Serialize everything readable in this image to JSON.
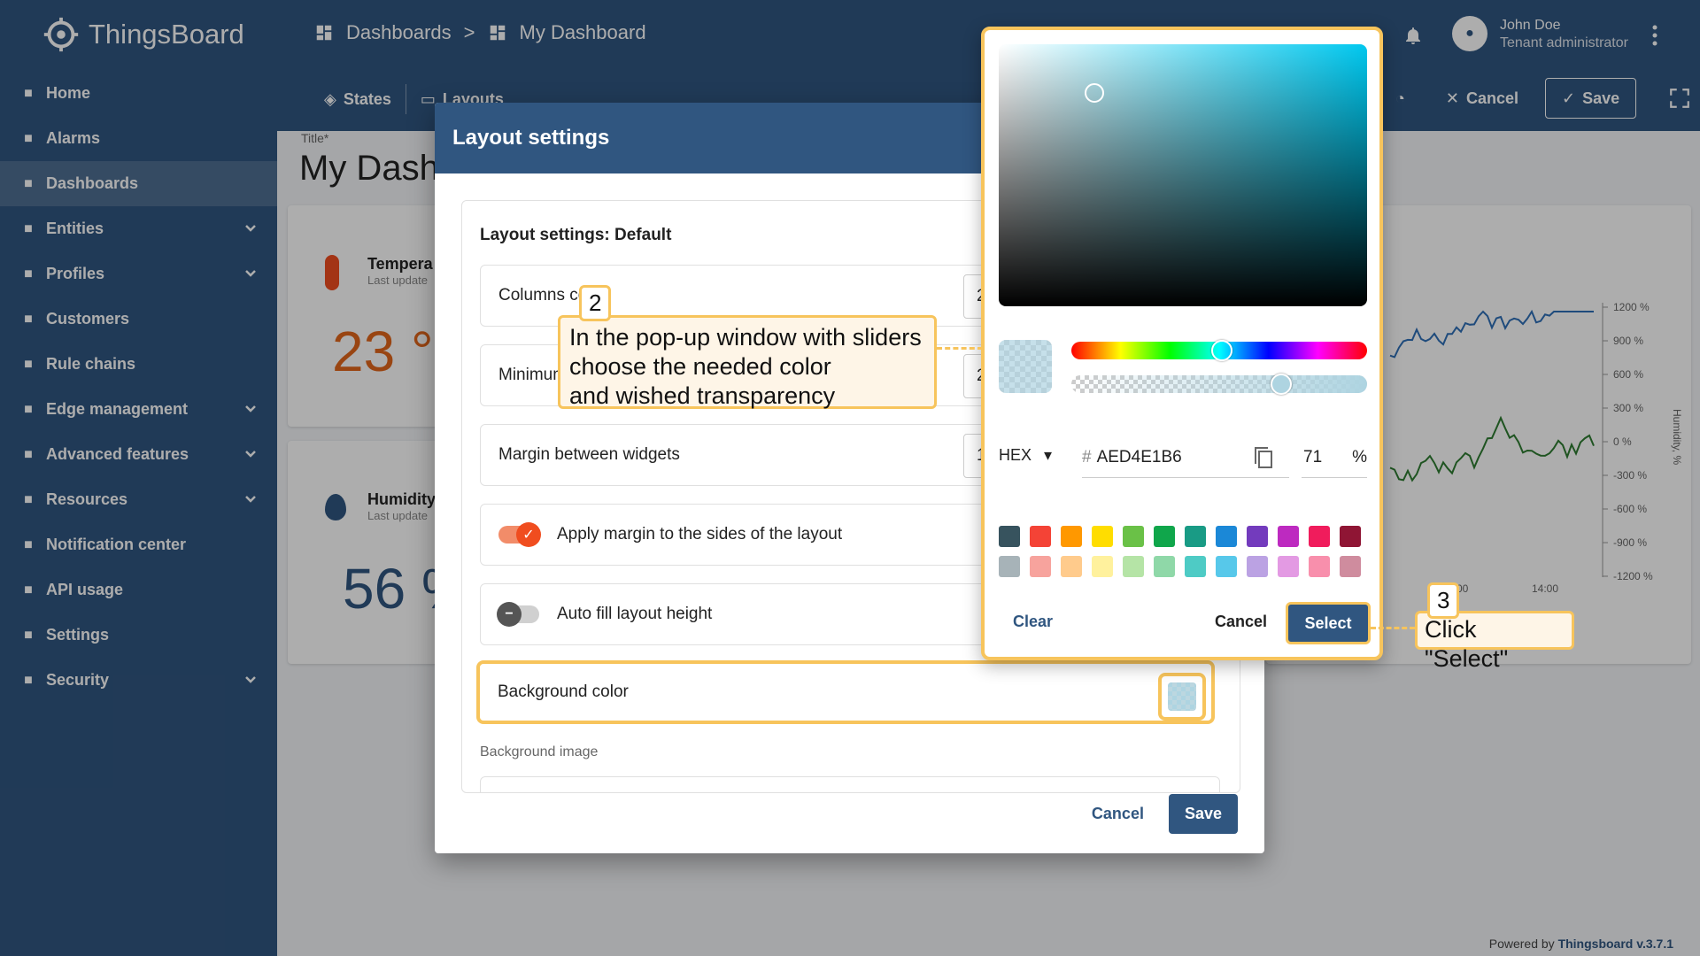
{
  "app": {
    "logo_text": "ThingsBoard",
    "breadcrumb": [
      "Dashboards",
      ">",
      "My Dashboard"
    ],
    "toolbar": {
      "states": "States",
      "layouts": "Layouts"
    },
    "user": {
      "name": "John Doe",
      "role": "Tenant administrator"
    },
    "actions": {
      "cancel": "Cancel",
      "save": "Save"
    },
    "title_label": "Title*",
    "title_value": "My Dash",
    "powered_by_prefix": "Powered by",
    "powered_by_link": "Thingsboard v.3.7.1"
  },
  "sidebar": {
    "items": [
      {
        "label": "Home",
        "icon": "home-icon"
      },
      {
        "label": "Alarms",
        "icon": "alarm-icon"
      },
      {
        "label": "Dashboards",
        "icon": "dashboard-icon"
      },
      {
        "label": "Entities",
        "icon": "entities-icon"
      },
      {
        "label": "Profiles",
        "icon": "profiles-icon"
      },
      {
        "label": "Customers",
        "icon": "customers-icon"
      },
      {
        "label": "Rule chains",
        "icon": "rule-chains-icon"
      },
      {
        "label": "Edge management",
        "icon": "edge-icon"
      },
      {
        "label": "Advanced features",
        "icon": "tools-icon"
      },
      {
        "label": "Resources",
        "icon": "folder-icon"
      },
      {
        "label": "Notification center",
        "icon": "notification-icon"
      },
      {
        "label": "API usage",
        "icon": "chart-icon"
      },
      {
        "label": "Settings",
        "icon": "gear-icon"
      },
      {
        "label": "Security",
        "icon": "shield-icon"
      }
    ]
  },
  "cards": {
    "temperature": {
      "name": "Tempera",
      "sub": "Last update",
      "value": "23 °"
    },
    "humidity": {
      "name": "Humidity",
      "sub": "Last update",
      "value": "56 %"
    }
  },
  "chart": {
    "y_ticks": [
      "1200 %",
      "900 %",
      "600 %",
      "300 %",
      "0 %",
      "-300 %",
      "-600 %",
      "-900 %",
      "-1200 %"
    ],
    "x_ticks": [
      "00",
      "14:00"
    ],
    "y_label": "Humidity, %",
    "series_colors": [
      "#2f6fb7",
      "#2f7d32"
    ]
  },
  "dialog": {
    "title": "Layout settings",
    "subtitle": "Layout settings: Default",
    "rows": {
      "columns_count": {
        "label": "Columns count",
        "value": "2"
      },
      "minimum": {
        "label": "Minimum",
        "value": "2"
      },
      "margin": {
        "label": "Margin between widgets",
        "value": "1"
      },
      "apply_margin": {
        "label": "Apply margin to the sides of the layout"
      },
      "auto_fill": {
        "label": "Auto fill layout height"
      },
      "background_color": {
        "label": "Background color"
      }
    },
    "background_image_label": "Background image",
    "cancel": "Cancel",
    "save": "Save"
  },
  "picker": {
    "format": "HEX",
    "hash": "#",
    "hex_value": "AED4E1B6",
    "alpha_value": "71",
    "alpha_unit": "%",
    "selected_color": "#aed4e1",
    "hue_fraction": 0.51,
    "alpha_fraction": 0.71,
    "palette": [
      "#37535e",
      "#f44336",
      "#ff9800",
      "#ffdd00",
      "#6ac147",
      "#10a64b",
      "#199b85",
      "#1b88d7",
      "#733bbd",
      "#bd2ac0",
      "#f01c5c",
      "#8f1534",
      "#a7b3b8",
      "#f7a39d",
      "#ffcb8c",
      "#fff19d",
      "#b5e4a6",
      "#8fd8a8",
      "#4ecbc5",
      "#57c8ea",
      "#bba2e3",
      "#e39ae3",
      "#f88fac",
      "#cf8c9e"
    ],
    "clear": "Clear",
    "cancel": "Cancel",
    "select": "Select"
  },
  "callouts": {
    "step2_num": "2",
    "step2_text": "In the pop-up window with sliders\nchoose the needed color\nand wished transparency",
    "step3_num": "3",
    "step3_text": "Click \"Select\""
  }
}
